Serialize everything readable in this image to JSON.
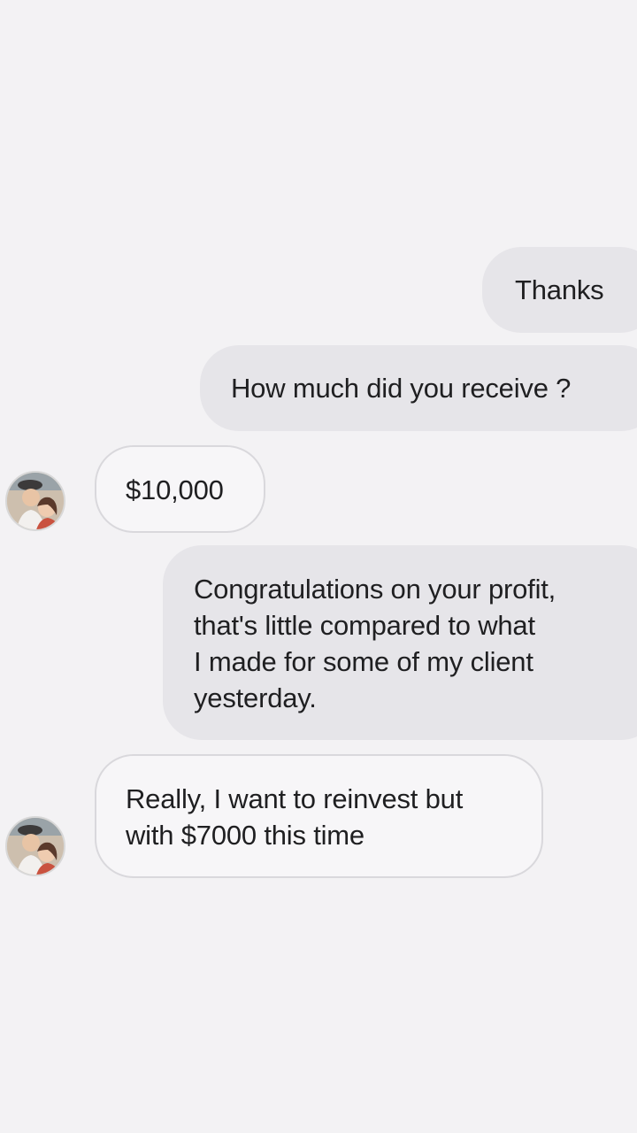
{
  "messages": [
    {
      "sender": "me",
      "text": "Thanks"
    },
    {
      "sender": "me",
      "text": "How much did you receive ?"
    },
    {
      "sender": "contact",
      "text": "$10,000"
    },
    {
      "sender": "me",
      "text": "Congratulations on your profit,\nthat's little compared to what\nI made for some of my client\nyesterday."
    },
    {
      "sender": "contact",
      "text": "Really, I want to reinvest but\nwith $7000 this time"
    }
  ],
  "colors": {
    "background": "#f3f2f4",
    "outgoing_bubble": "#e6e5e9",
    "incoming_bubble": "#f7f6f8",
    "incoming_border": "#d9d8dc"
  },
  "icons": {
    "contact_avatar": "couple-photo-avatar"
  }
}
